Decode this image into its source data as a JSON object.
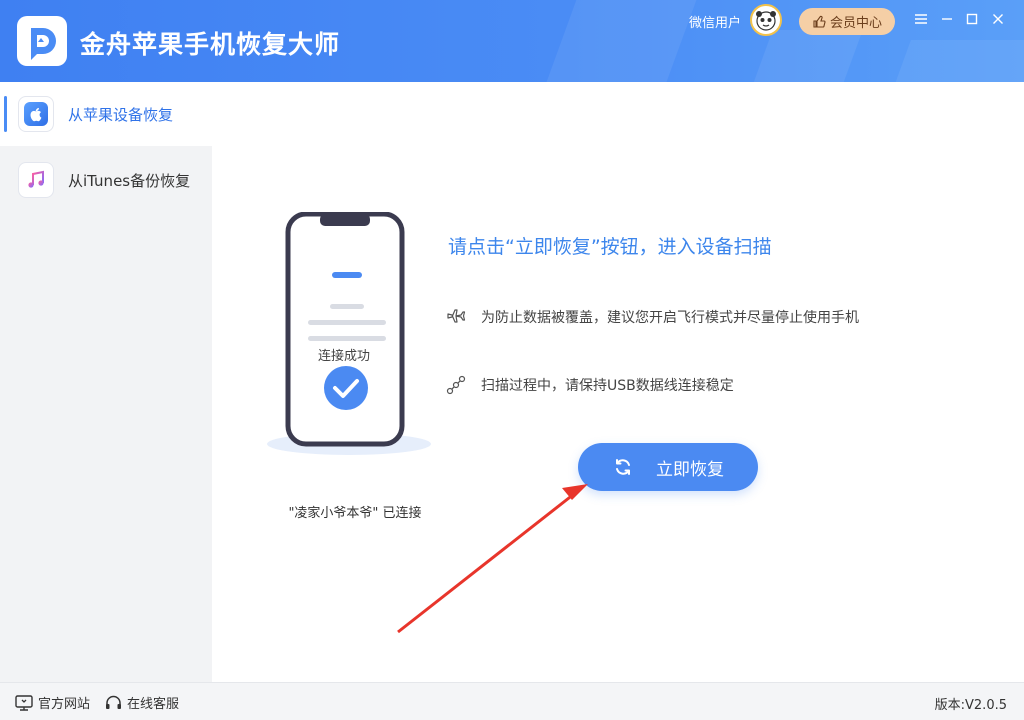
{
  "app": {
    "title": "金舟苹果手机恢复大师"
  },
  "header": {
    "user_name": "微信用户",
    "vip_label": "会员中心"
  },
  "sidebar": {
    "items": [
      {
        "label": "从苹果设备恢复",
        "active": true,
        "icon": "apple-icon"
      },
      {
        "label": "从iTunes备份恢复",
        "active": false,
        "icon": "music-note-icon"
      }
    ]
  },
  "main": {
    "phone_status": "连接成功",
    "device_status": "\"凌家小爷本爷\" 已连接",
    "headline": "请点击“立即恢复”按钮，进入设备扫描",
    "tips": [
      {
        "icon": "airplane-icon",
        "text": "为防止数据被覆盖，建议您开启飞行模式并尽量停止使用手机"
      },
      {
        "icon": "usb-cable-icon",
        "text": "扫描过程中，请保持USB数据线连接稳定"
      }
    ],
    "recover_label": "立即恢复"
  },
  "footer": {
    "website_label": "官方网站",
    "support_label": "在线客服",
    "version": "版本:V2.0.5"
  },
  "colors": {
    "brand": "#4a8cf5",
    "accent_text": "#3d86ec",
    "vip_bg": "#f5cfa6",
    "arrow": "#e8352b"
  }
}
